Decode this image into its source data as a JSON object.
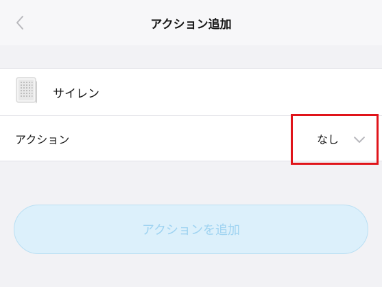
{
  "header": {
    "title": "アクション追加",
    "back_icon": "chevron-left-icon"
  },
  "device": {
    "name": "サイレン",
    "icon": "siren-device-icon"
  },
  "action": {
    "label": "アクション",
    "selected_value": "なし",
    "dropdown_icon": "chevron-down-icon"
  },
  "footer": {
    "add_button_label": "アクションを追加"
  },
  "colors": {
    "background": "#f2f2f5",
    "card": "#ffffff",
    "button_fill": "#dcf0fb",
    "button_text": "#9fd3f1",
    "highlight": "#e0141a"
  }
}
